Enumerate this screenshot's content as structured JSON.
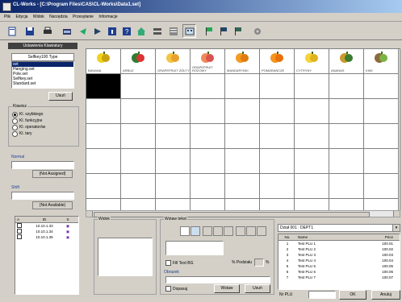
{
  "window": {
    "title": "CL-Works - [C:\\Program Files\\CAS\\CL-Works\\Data1.set]"
  },
  "menu": [
    "Plik",
    "Edycja",
    "Widok",
    "Narzędzia",
    "Przesyłanie",
    "Informacje"
  ],
  "left_panel": {
    "header": "Ustawienia Klawiatury",
    "kbd_type_label": "Selfkey100 Type",
    "kbd_list": [
      "set",
      "Hanging.set",
      "Pole.set",
      "Selfkey.set",
      "Standard.set"
    ],
    "delete_button": "Usuń",
    "key_group": "Klawisz",
    "key_options": [
      "Kl. szybkiego",
      "Kl. funkcyjne",
      "Kl. operatorów",
      "Kl. tary"
    ],
    "normal_label": "Normal",
    "normal_value": "(Not Assigned)",
    "shift_label": "Shift",
    "shift_value": "(Not Available)"
  },
  "scale_list": {
    "columns": [
      "A",
      "ID",
      "S"
    ],
    "rows": [
      {
        "id": "10.10.1.33"
      },
      {
        "id": "10.10.1.34"
      },
      {
        "id": "10.10.1.35"
      }
    ]
  },
  "grid": {
    "fruits": [
      {
        "name": "BANANA",
        "icon": "banana-icon"
      },
      {
        "name": "ARBUZ",
        "icon": "watermelon-icon"
      },
      {
        "name": "GRAPEFRUIT ŻÓŁTY",
        "icon": "grapefruit-icon"
      },
      {
        "name": "GRAPEFRUIT RÓŻOWY",
        "icon": "pink-grapefruit-icon"
      },
      {
        "name": "MANDARYNKI",
        "icon": "mandarin-icon"
      },
      {
        "name": "POMARAŃCZE",
        "icon": "orange-icon"
      },
      {
        "name": "CYTRYNY",
        "icon": "lemon-icon"
      },
      {
        "name": "ANANAS",
        "icon": "pineapple-icon"
      },
      {
        "name": "KIWI",
        "icon": "kiwi-icon"
      }
    ]
  },
  "bottom": {
    "preview_group": "Widok",
    "text_group": "Wstaw tekst",
    "fill_text_bg": "Fill Text BG",
    "percent_label": "% Podziału",
    "percent_unit": "%",
    "image_group": "Obrazek",
    "stretch_label": "Dopasuj",
    "insert_button": "Wstaw",
    "delete_button": "Usuń"
  },
  "dept": {
    "selected": "Dział 001 : DEPT1",
    "columns": [
      "No.",
      "Name",
      "Price"
    ],
    "rows": [
      {
        "no": "1",
        "name": "Test PLU 1",
        "price": "100.01"
      },
      {
        "no": "2",
        "name": "Test PLU 2",
        "price": "100.02"
      },
      {
        "no": "3",
        "name": "Test PLU 3",
        "price": "100.03"
      },
      {
        "no": "4",
        "name": "Test PLU 4",
        "price": "100.04"
      },
      {
        "no": "5",
        "name": "Test PLU 5",
        "price": "100.05"
      },
      {
        "no": "6",
        "name": "Test PLU 6",
        "price": "100.06"
      },
      {
        "no": "7",
        "name": "Test PLU 7",
        "price": "100.07"
      }
    ],
    "nr_plu_label": "Nr PLU",
    "ok_button": "OK",
    "cancel_button": "Anuluj"
  }
}
